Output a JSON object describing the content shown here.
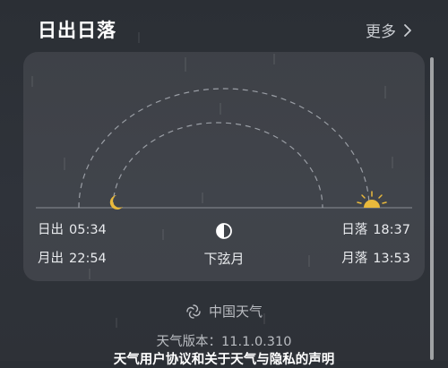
{
  "header": {
    "title": "日出日落",
    "more_label": "更多"
  },
  "card": {
    "sunrise": {
      "label": "日出",
      "time": "05:34"
    },
    "sunset": {
      "label": "日落",
      "time": "18:37"
    },
    "moonrise": {
      "label": "月出",
      "time": "22:54"
    },
    "moonset": {
      "label": "月落",
      "time": "13:53"
    },
    "moon_phase": "下弦月"
  },
  "footer": {
    "provider": "中国天气",
    "version": "天气版本：11.1.0.310",
    "agreement_user": "天气用户协议",
    "agreement_and": "和",
    "agreement_privacy": "关于天气与隐私的声明"
  },
  "colors": {
    "sun": "#e9b93c",
    "moon": "#e9b93c",
    "card_bg": "#3c4047",
    "text": "#e8eaed",
    "muted": "#b9bcc1"
  },
  "icons": [
    "chevron-right-icon",
    "moon-icon",
    "sun-icon",
    "half-moon-icon",
    "provider-logo-icon"
  ]
}
